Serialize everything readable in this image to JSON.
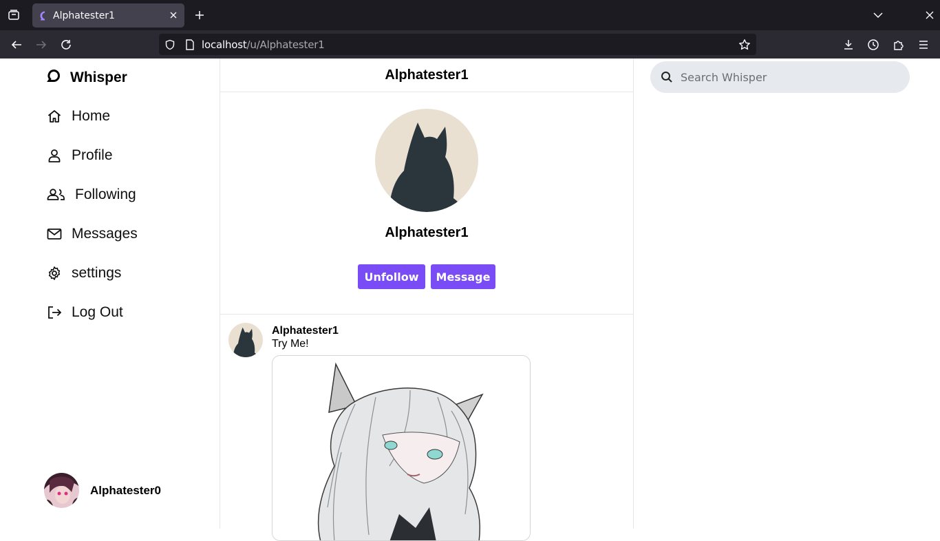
{
  "browser": {
    "tab_title": "Alphatester1",
    "url_host": "localhost",
    "url_path": "/u/Alphatester1"
  },
  "sidebar": {
    "brand": "Whisper",
    "items": [
      {
        "label": "Home",
        "icon": "home-icon"
      },
      {
        "label": "Profile",
        "icon": "user-icon"
      },
      {
        "label": "Following",
        "icon": "users-icon"
      },
      {
        "label": "Messages",
        "icon": "mail-icon"
      },
      {
        "label": "settings",
        "icon": "gear-icon"
      },
      {
        "label": "Log Out",
        "icon": "logout-icon"
      }
    ],
    "account_name": "Alphatester0"
  },
  "main": {
    "header_title": "Alphatester1",
    "profile_name": "Alphatester1",
    "unfollow_label": "Unfollow",
    "message_label": "Message",
    "post": {
      "author": "Alphatester1",
      "text": "Try Me!"
    }
  },
  "search": {
    "placeholder": "Search Whisper"
  },
  "colors": {
    "accent": "#7a4cf6",
    "search_bg": "#e6e9ed"
  }
}
